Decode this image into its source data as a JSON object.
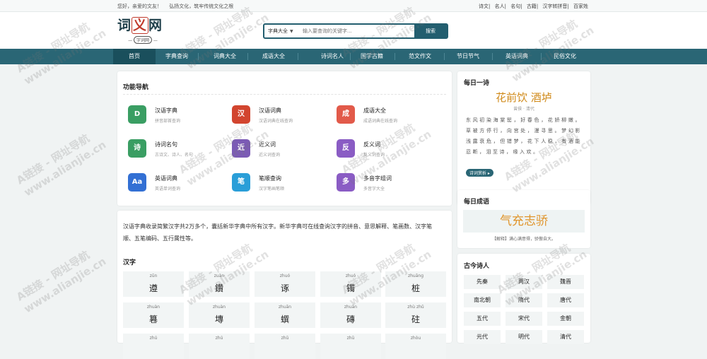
{
  "topbar": {
    "greeting": "您好，亲爱的文友！",
    "slogan": "弘扬文化，筑牢传统文化之根",
    "links": [
      "诗文",
      "名人",
      "名句",
      "古籍",
      "汉字转拼音",
      "百家姓"
    ]
  },
  "logo": {
    "title_a": "词",
    "title_b": "义",
    "title_c": "网",
    "subtitle": "字词网"
  },
  "search": {
    "category": "字典大全",
    "placeholder": "输入要查询的关键字...",
    "button": "搜索"
  },
  "nav": [
    "首页",
    "字典查询",
    "词典大全",
    "成语大全",
    "诗词名人",
    "国学古籍",
    "范文作文",
    "节日节气",
    "英语词典",
    "民俗文化"
  ],
  "func": {
    "title": "功能导航",
    "items": [
      {
        "name": "汉语字典",
        "desc": "拼音部首查询",
        "glyph": "D",
        "color": "#3a9e63"
      },
      {
        "name": "汉语词典",
        "desc": "汉语词典在线查询",
        "glyph": "汉",
        "color": "#d2452f"
      },
      {
        "name": "成语大全",
        "desc": "成语词典在线查询",
        "glyph": "成",
        "color": "#e25a4a"
      },
      {
        "name": "诗词名句",
        "desc": "古诗文、诗人、名句",
        "glyph": "诗",
        "color": "#3a9e63"
      },
      {
        "name": "近义词",
        "desc": "近义词查询",
        "glyph": "近",
        "color": "#7b5bb5"
      },
      {
        "name": "反义词",
        "desc": "反义词查询",
        "glyph": "反",
        "color": "#8a5cc4"
      },
      {
        "name": "英语词典",
        "desc": "英语单词查询",
        "glyph": "Aa",
        "color": "#3370d4"
      },
      {
        "name": "笔顺查询",
        "desc": "汉字笔画笔顺",
        "glyph": "笔",
        "color": "#2a9ed8"
      },
      {
        "name": "多音字组词",
        "desc": "多音字大全",
        "glyph": "多",
        "color": "#8a5cc4"
      }
    ]
  },
  "intro": "汉语字典收录简繁汉字共2万多个，囊括新华字典中所有汉字。新华字典可在线查询汉字的拼音、意思解释、笔画数、汉字笔顺、五笔编码、五行属性等。",
  "hanzi": {
    "title": "汉字",
    "cells": [
      {
        "py": "zūn",
        "ch": "遵"
      },
      {
        "py": "zuàn",
        "ch": "鑽"
      },
      {
        "py": "zhuó",
        "ch": "诼"
      },
      {
        "py": "zhuó",
        "ch": "镯"
      },
      {
        "py": "zhuāng",
        "ch": "桩"
      },
      {
        "py": "zhuàn",
        "ch": "篹"
      },
      {
        "py": "zhuàn",
        "ch": "塼"
      },
      {
        "py": "zhuān",
        "ch": "蟤"
      },
      {
        "py": "zhuān",
        "ch": "磚"
      },
      {
        "py": "zhù zhǔ",
        "ch": "砫"
      },
      {
        "py": "zhú",
        "ch": ""
      },
      {
        "py": "zhú",
        "ch": ""
      },
      {
        "py": "zhū",
        "ch": ""
      },
      {
        "py": "zhū",
        "ch": ""
      },
      {
        "py": "zhòu",
        "ch": ""
      }
    ]
  },
  "poem": {
    "title": "每日一诗",
    "name": "花前饮 酒垆",
    "author": "曾揆 · 清代",
    "body": "东风初染海棠罂，好春色，花娇柳嫩。草被方停行，向宫处，漫寻思。梦幻影浅露衰危，但错梦，花下人稳，有酒能忍断，泪至诗，缘入欢。",
    "button": "诗词赏析 ▸"
  },
  "idiom": {
    "title": "每日成语",
    "name": "气充志骄",
    "explain": "【解释】满心满意得，骄傲自大。"
  },
  "poets": {
    "title": "古今诗人",
    "eras": [
      "先秦",
      "两汉",
      "魏晋",
      "南北朝",
      "隋代",
      "唐代",
      "五代",
      "宋代",
      "金朝",
      "元代",
      "明代",
      "清代"
    ]
  },
  "watermark": {
    "line1": "A链接 - 网址导航",
    "line2": "www.alianjie.cn"
  }
}
